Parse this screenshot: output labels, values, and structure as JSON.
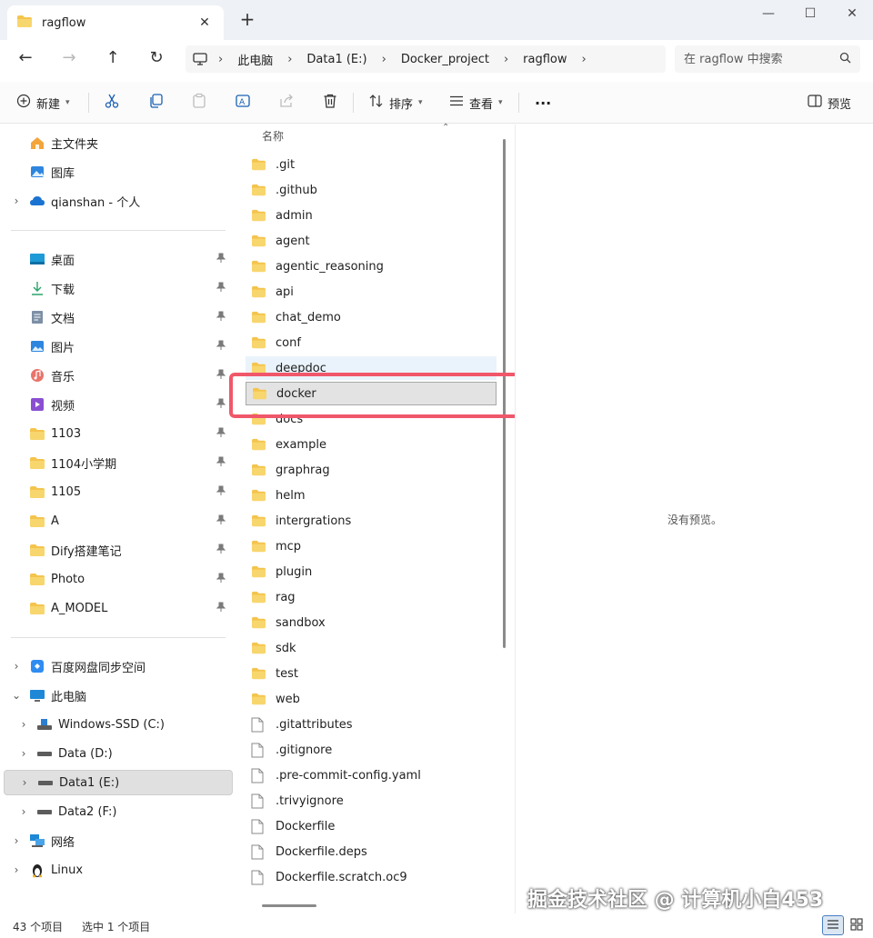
{
  "tab": {
    "title": "ragflow"
  },
  "address": {
    "crumbs": [
      "此电脑",
      "Data1 (E:)",
      "Docker_project",
      "ragflow"
    ],
    "search_placeholder": "在 ragflow 中搜索"
  },
  "toolbar": {
    "new_label": "新建",
    "sort_label": "排序",
    "view_label": "查看",
    "preview_label": "预览"
  },
  "sidebar": {
    "quick": [
      {
        "label": "主文件夹",
        "icon": "home-icon"
      },
      {
        "label": "图库",
        "icon": "gallery-icon"
      },
      {
        "label": "qianshan - 个人",
        "icon": "cloud-icon"
      }
    ],
    "pinned": [
      {
        "label": "桌面",
        "icon": "desktop-icon"
      },
      {
        "label": "下载",
        "icon": "download-icon"
      },
      {
        "label": "文档",
        "icon": "document-icon"
      },
      {
        "label": "图片",
        "icon": "pictures-icon"
      },
      {
        "label": "音乐",
        "icon": "music-icon"
      },
      {
        "label": "视频",
        "icon": "video-icon"
      },
      {
        "label": "1103",
        "icon": "folder-icon"
      },
      {
        "label": "1104小学期",
        "icon": "folder-icon"
      },
      {
        "label": "1105",
        "icon": "folder-icon"
      },
      {
        "label": "A",
        "icon": "folder-icon"
      },
      {
        "label": "Dify搭建笔记",
        "icon": "folder-icon"
      },
      {
        "label": "Photo",
        "icon": "folder-icon"
      },
      {
        "label": "A_MODEL",
        "icon": "folder-icon"
      }
    ],
    "devices": [
      {
        "label": "百度网盘同步空间",
        "icon": "baidu-icon"
      },
      {
        "label": "此电脑",
        "icon": "computer-icon"
      },
      {
        "label": "Windows-SSD (C:)",
        "icon": "drive-icon"
      },
      {
        "label": "Data (D:)",
        "icon": "drive-icon"
      },
      {
        "label": "Data1 (E:)",
        "icon": "drive-icon"
      },
      {
        "label": "Data2 (F:)",
        "icon": "drive-icon"
      },
      {
        "label": "网络",
        "icon": "network-icon"
      },
      {
        "label": "Linux",
        "icon": "linux-icon"
      }
    ]
  },
  "filelist": {
    "column_header": "名称",
    "items": [
      {
        "name": ".git",
        "type": "folder"
      },
      {
        "name": ".github",
        "type": "folder"
      },
      {
        "name": "admin",
        "type": "folder"
      },
      {
        "name": "agent",
        "type": "folder"
      },
      {
        "name": "agentic_reasoning",
        "type": "folder"
      },
      {
        "name": "api",
        "type": "folder"
      },
      {
        "name": "chat_demo",
        "type": "folder"
      },
      {
        "name": "conf",
        "type": "folder"
      },
      {
        "name": "deepdoc",
        "type": "folder"
      },
      {
        "name": "docker",
        "type": "folder"
      },
      {
        "name": "docs",
        "type": "folder"
      },
      {
        "name": "example",
        "type": "folder"
      },
      {
        "name": "graphrag",
        "type": "folder"
      },
      {
        "name": "helm",
        "type": "folder"
      },
      {
        "name": "intergrations",
        "type": "folder"
      },
      {
        "name": "mcp",
        "type": "folder"
      },
      {
        "name": "plugin",
        "type": "folder"
      },
      {
        "name": "rag",
        "type": "folder"
      },
      {
        "name": "sandbox",
        "type": "folder"
      },
      {
        "name": "sdk",
        "type": "folder"
      },
      {
        "name": "test",
        "type": "folder"
      },
      {
        "name": "web",
        "type": "folder"
      },
      {
        "name": ".gitattributes",
        "type": "file"
      },
      {
        "name": ".gitignore",
        "type": "file"
      },
      {
        "name": ".pre-commit-config.yaml",
        "type": "file"
      },
      {
        "name": ".trivyignore",
        "type": "file"
      },
      {
        "name": "Dockerfile",
        "type": "file"
      },
      {
        "name": "Dockerfile.deps",
        "type": "file"
      },
      {
        "name": "Dockerfile.scratch.oc9",
        "type": "file"
      }
    ]
  },
  "preview": {
    "empty_text": "没有预览。"
  },
  "status": {
    "item_count": "43 个项目",
    "selection": "选中 1 个项目"
  },
  "watermark": "掘金技术社区 @ 计算机小白453",
  "colors": {
    "accent": "#0067c0",
    "folder": "#f4c44d",
    "highlight": "#f0576b"
  }
}
